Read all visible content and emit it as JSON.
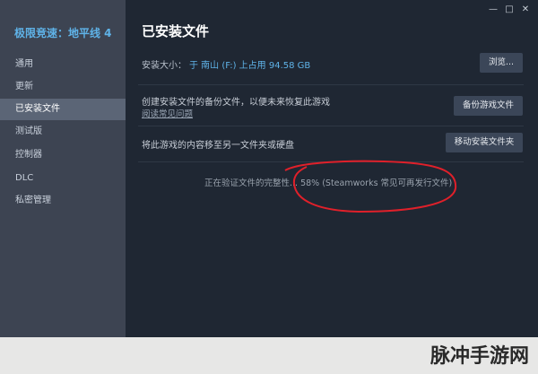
{
  "sidebar": {
    "game_title": "极限竞速：地平线 4",
    "items": [
      {
        "label": "通用",
        "active": false
      },
      {
        "label": "更新",
        "active": false
      },
      {
        "label": "已安装文件",
        "active": true
      },
      {
        "label": "测试版",
        "active": false
      },
      {
        "label": "控制器",
        "active": false
      },
      {
        "label": "DLC",
        "active": false
      },
      {
        "label": "私密管理",
        "active": false
      }
    ]
  },
  "window": {
    "min_icon": "minimize-icon",
    "max_icon": "maximize-icon",
    "close_icon": "close-icon"
  },
  "main": {
    "title": "已安装文件",
    "install_size_label": "安装大小：",
    "install_size_value": "于 南山 (F:) 上占用 94.58 GB",
    "browse_button": "浏览...",
    "backup_text": "创建安装文件的备份文件，以便未来恢复此游戏",
    "backup_link": "阅读常见问题",
    "backup_button": "备份游戏文件",
    "move_text": "将此游戏的内容移至另一文件夹或硬盘",
    "move_button": "移动安装文件夹",
    "verify_status": "正在验证文件的完整性... 58% (Steamworks 常见可再发行文件)",
    "verify_progress_percent": 58
  },
  "colors": {
    "accent": "#5fb3e8",
    "sidebar_bg": "#3d4452",
    "main_bg": "#1f2733",
    "annotation_red": "#e0202a"
  },
  "watermark": "脉冲手游网"
}
